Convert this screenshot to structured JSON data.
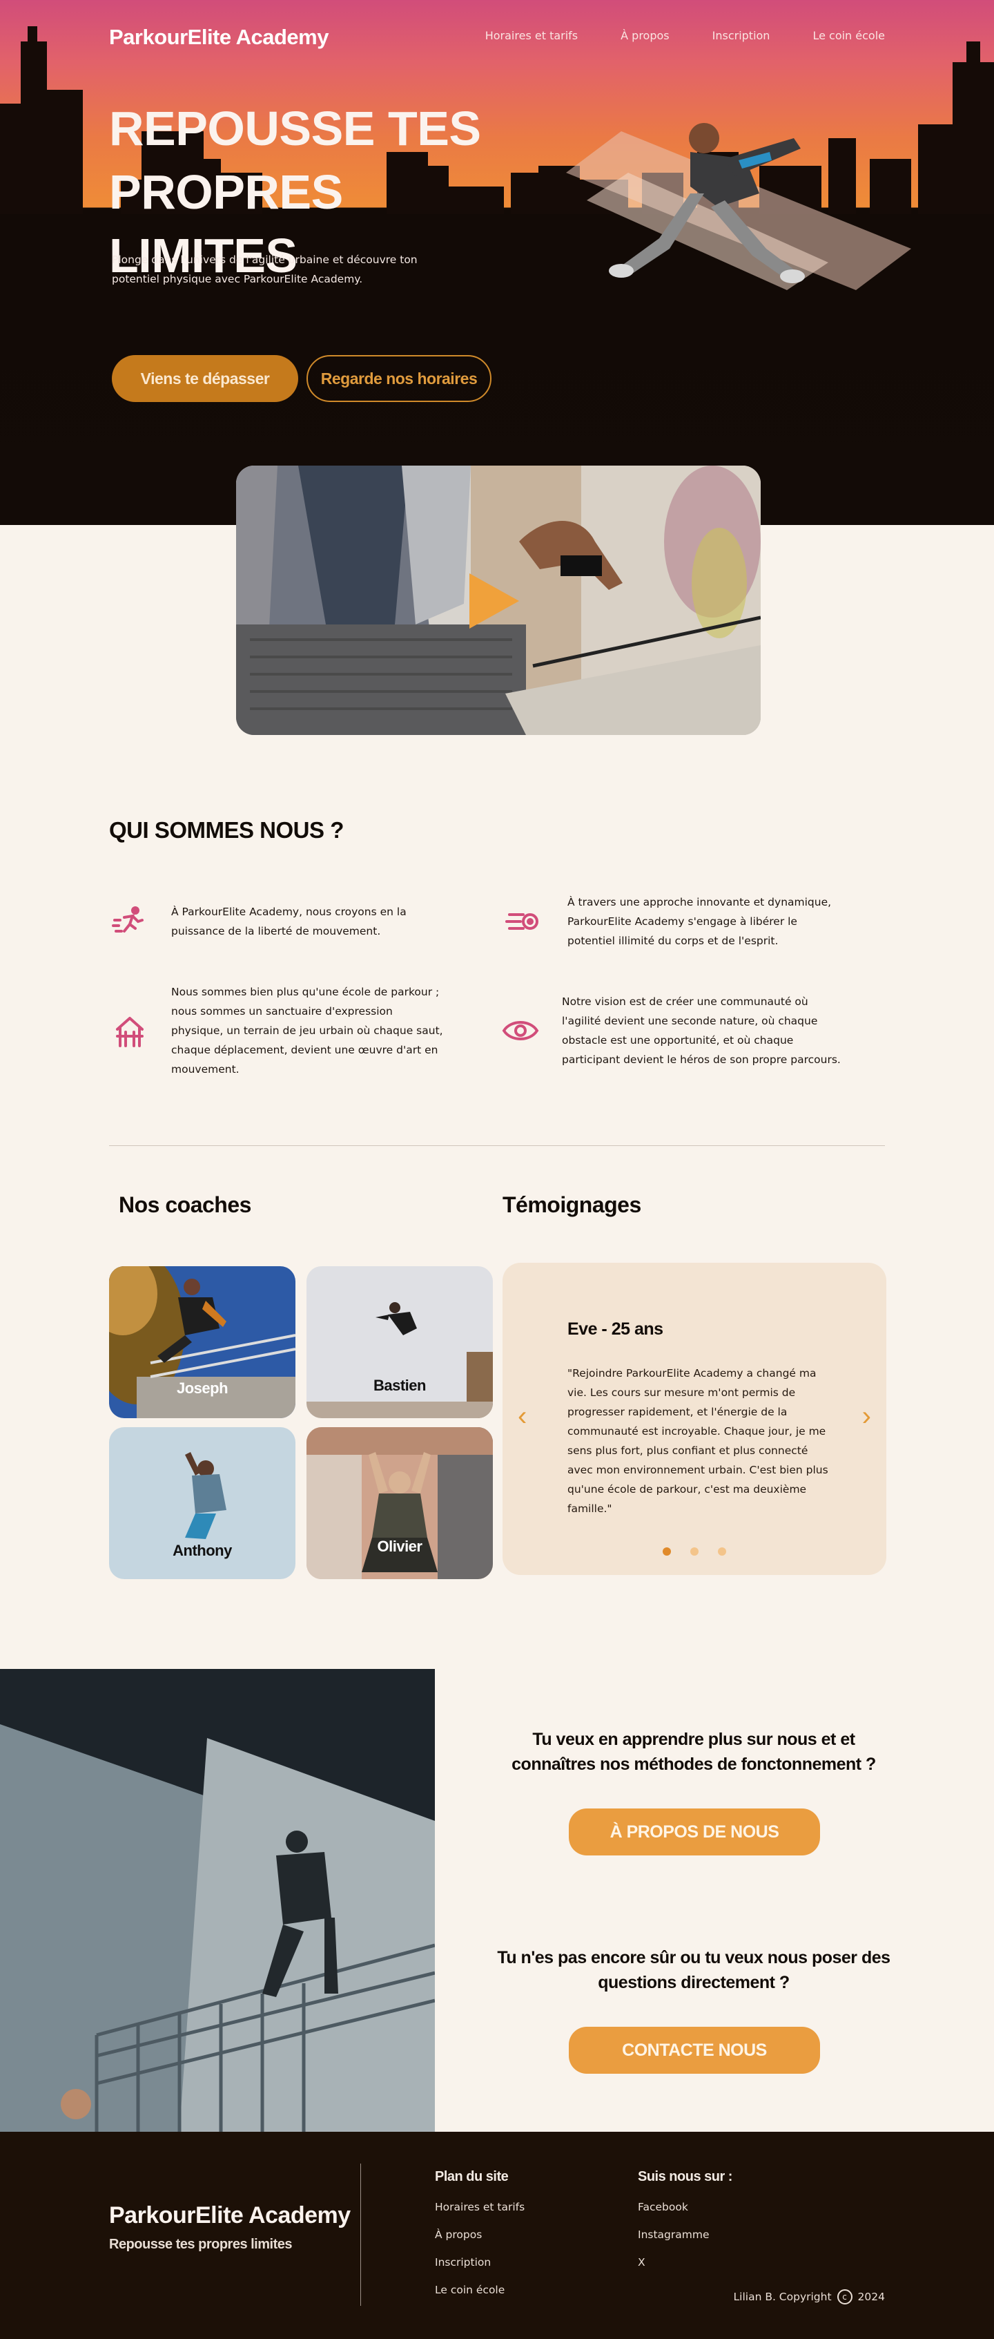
{
  "nav": {
    "brand": "ParkourElite Academy",
    "links": [
      "Horaires et tarifs",
      "À propos",
      "Inscription",
      "Le coin école"
    ]
  },
  "hero": {
    "title_line1": "REPOUSSE TES",
    "title_line2": "PROPRES LIMITES",
    "subtitle": "Plonge dans l'univers de l'agilité urbaine et découvre ton potentiel physique avec ParkourElite Academy.",
    "primary_button": "Viens te dépasser",
    "secondary_button": "Regarde nos horaires"
  },
  "about": {
    "title": "QUI SOMMES NOUS ?",
    "features": [
      {
        "icon": "runner-icon",
        "text": "À ParkourElite Academy, nous croyons en la puissance de la liberté de mouvement."
      },
      {
        "icon": "speed-icon",
        "text": "À travers une approche innovante et dynamique, ParkourElite Academy s'engage à libérer le potentiel illimité du corps et de l'esprit."
      },
      {
        "icon": "playground-icon",
        "text": "Nous sommes bien plus qu'une école de parkour ; nous sommes un sanctuaire d'expression physique, un terrain de jeu urbain où chaque saut, chaque déplacement, devient une œuvre d'art en mouvement."
      },
      {
        "icon": "eye-icon",
        "text": "Notre vision est de créer une communauté où l'agilité devient une seconde nature, où chaque obstacle est une opportunité, et où chaque participant devient le héros de son propre parcours."
      }
    ]
  },
  "coaches": {
    "title": "Nos coaches",
    "items": [
      "Joseph",
      "Bastien",
      "Anthony",
      "Olivier"
    ]
  },
  "testimonials": {
    "title": "Témoignages",
    "name": "Eve - 25 ans",
    "text": "\"Rejoindre ParkourElite Academy a changé ma vie. Les cours sur mesure m'ont permis de progresser rapidement, et l'énergie de la communauté est incroyable. Chaque jour, je me sens plus fort, plus confiant et plus connecté avec mon environnement urbain. C'est bien plus qu'une école de parkour, c'est ma deuxième famille.\"",
    "prev": "‹",
    "next": "›",
    "dots": 3,
    "active_dot": 1
  },
  "cta": {
    "question1": "Tu veux en apprendre plus sur nous et et connaîtres nos méthodes de fonctonnement ?",
    "button1": "À PROPOS DE NOUS",
    "question2": "Tu n'es pas encore sûr ou tu veux nous poser des questions directement ?",
    "button2": "CONTACTE NOUS"
  },
  "footer": {
    "brand": "ParkourElite Academy",
    "tagline": "Repousse tes propres limites",
    "sitemap_title": "Plan du site",
    "sitemap": [
      "Horaires et tarifs",
      "À propos",
      "Inscription",
      "Le coin école"
    ],
    "social_title": "Suis nous sur :",
    "social": [
      "Facebook",
      "Instagramme",
      "X"
    ],
    "copyright": "Lilian B. Copyright",
    "copyright_symbol": "c",
    "year": "2024"
  },
  "colors": {
    "accent": "#ea9d40",
    "pink": "#d14d7a",
    "dark": "#1c1007",
    "cream": "#f9f3ec"
  }
}
